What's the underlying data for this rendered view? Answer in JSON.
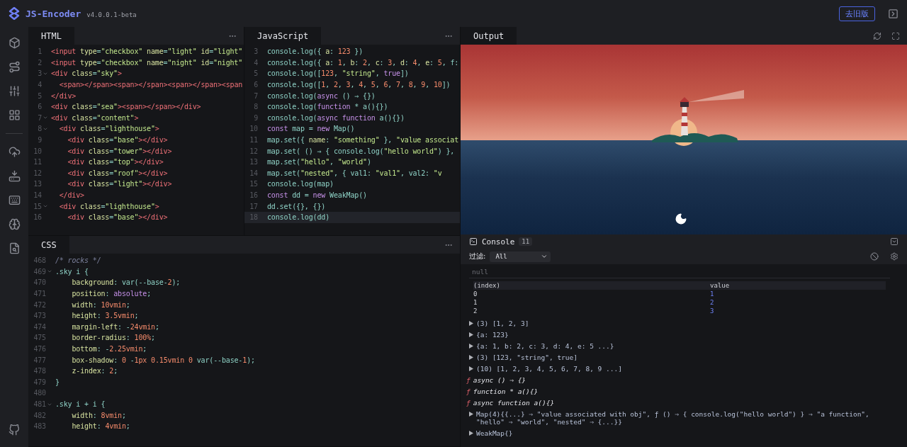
{
  "header": {
    "app_name": "JS-Encoder",
    "version": "v4.0.0.1-beta",
    "old_version_button": "去旧版"
  },
  "html_editor": {
    "tab": "HTML",
    "lines": [
      {
        "n": "1",
        "code": "<input type=\"checkbox\" name=\"light\" id=\"light\"",
        "fold": false
      },
      {
        "n": "2",
        "code": "<input type=\"checkbox\" name=\"night\" id=\"night\"",
        "fold": false
      },
      {
        "n": "3",
        "code": "<div class=\"sky\">",
        "fold": true
      },
      {
        "n": "4",
        "code": "  <span></span><span></span><span></span><span",
        "fold": false
      },
      {
        "n": "5",
        "code": "</div>",
        "fold": false
      },
      {
        "n": "6",
        "code": "<div class=\"sea\"><span></span></div>",
        "fold": false
      },
      {
        "n": "7",
        "code": "<div class=\"content\">",
        "fold": true
      },
      {
        "n": "8",
        "code": "  <div class=\"lighthouse\">",
        "fold": true
      },
      {
        "n": "9",
        "code": "    <div class=\"base\"></div>",
        "fold": false
      },
      {
        "n": "10",
        "code": "    <div class=\"tower\"></div>",
        "fold": false
      },
      {
        "n": "11",
        "code": "    <div class=\"top\"></div>",
        "fold": false
      },
      {
        "n": "12",
        "code": "    <div class=\"roof\"></div>",
        "fold": false
      },
      {
        "n": "13",
        "code": "    <div class=\"light\"></div>",
        "fold": false
      },
      {
        "n": "14",
        "code": "  </div>",
        "fold": false
      },
      {
        "n": "15",
        "code": "  <div class=\"lighthouse\">",
        "fold": true
      },
      {
        "n": "16",
        "code": "    <div class=\"base\"></div>",
        "fold": false
      }
    ]
  },
  "js_editor": {
    "tab": "JavaScript",
    "lines": [
      {
        "n": "3",
        "code": "console.log({ a: 123 })",
        "fold": false,
        "active": false
      },
      {
        "n": "4",
        "code": "console.log({ a: 1, b: 2, c: 3, d: 4, e: 5, f:",
        "fold": false,
        "active": false
      },
      {
        "n": "5",
        "code": "console.log([123, \"string\", true])",
        "fold": false,
        "active": false
      },
      {
        "n": "6",
        "code": "console.log([1, 2, 3, 4, 5, 6, 7, 8, 9, 10])",
        "fold": false,
        "active": false
      },
      {
        "n": "7",
        "code": "console.log(async () ⇒ {})",
        "fold": false,
        "active": false
      },
      {
        "n": "8",
        "code": "console.log(function * a(){})",
        "fold": false,
        "active": false
      },
      {
        "n": "9",
        "code": "console.log(async function a(){})",
        "fold": false,
        "active": false
      },
      {
        "n": "10",
        "code": "const map = new Map()",
        "fold": false,
        "active": false
      },
      {
        "n": "11",
        "code": "map.set({ name: \"something\" }, \"value associat",
        "fold": false,
        "active": false
      },
      {
        "n": "12",
        "code": "map.set( () ⇒ { console.log(\"hello world\") },",
        "fold": false,
        "active": false
      },
      {
        "n": "13",
        "code": "map.set(\"hello\", \"world\")",
        "fold": false,
        "active": false
      },
      {
        "n": "14",
        "code": "map.set(\"nested\", { val1: \"val1\", val2: \"v",
        "fold": false,
        "active": false
      },
      {
        "n": "15",
        "code": "console.log(map)",
        "fold": false,
        "active": false
      },
      {
        "n": "16",
        "code": "const dd = new WeakMap()",
        "fold": false,
        "active": false
      },
      {
        "n": "17",
        "code": "dd.set({}, {})",
        "fold": false,
        "active": false
      },
      {
        "n": "18",
        "code": "console.log(dd)",
        "fold": false,
        "active": true
      }
    ]
  },
  "css_editor": {
    "tab": "CSS",
    "lines": [
      {
        "n": "468",
        "code": "/* rocks */",
        "fold": false
      },
      {
        "n": "469",
        "code": ".sky i {",
        "fold": true
      },
      {
        "n": "470",
        "code": "    background: var(--base-2);",
        "fold": false
      },
      {
        "n": "471",
        "code": "    position: absolute;",
        "fold": false
      },
      {
        "n": "472",
        "code": "    width: 10vmin;",
        "fold": false
      },
      {
        "n": "473",
        "code": "    height: 3.5vmin;",
        "fold": false
      },
      {
        "n": "474",
        "code": "    margin-left: -24vmin;",
        "fold": false
      },
      {
        "n": "475",
        "code": "    border-radius: 100%;",
        "fold": false
      },
      {
        "n": "476",
        "code": "    bottom: -2.25vmin;",
        "fold": false
      },
      {
        "n": "477",
        "code": "    box-shadow: 0 -1px 0.15vmin 0 var(--base-1);",
        "fold": false
      },
      {
        "n": "478",
        "code": "    z-index: 2;",
        "fold": false
      },
      {
        "n": "479",
        "code": "}",
        "fold": false
      },
      {
        "n": "480",
        "fold": false
      },
      {
        "n": "481",
        "code": ".sky i + i {",
        "fold": true
      },
      {
        "n": "482",
        "code": "    width: 8vmin;",
        "fold": false
      },
      {
        "n": "483",
        "code": "    height: 4vmin;",
        "fold": false
      }
    ]
  },
  "output": {
    "tab": "Output"
  },
  "console": {
    "title": "Console",
    "count": "11",
    "filter_label": "过滤:",
    "filter_value": "All",
    "entries": [
      {
        "kind": "plain",
        "text": "null"
      },
      {
        "kind": "table",
        "columns": [
          "(index)",
          "value"
        ],
        "rows": [
          [
            "0",
            "1"
          ],
          [
            "1",
            "2"
          ],
          [
            "2",
            "3"
          ]
        ]
      },
      {
        "kind": "object",
        "text": "(3) [1, 2, 3]"
      },
      {
        "kind": "object",
        "text": "{a: 123}"
      },
      {
        "kind": "object",
        "text": "{a: 1, b: 2, c: 3, d: 4, e: 5 ...}"
      },
      {
        "kind": "object",
        "text": "(3) [123, \"string\", true]"
      },
      {
        "kind": "object",
        "text": "(10) [1, 2, 3, 4, 5, 6, 7, 8, 9 ...]"
      },
      {
        "kind": "function",
        "prefix": "ƒ",
        "text": "async () ⇒ {}"
      },
      {
        "kind": "function",
        "prefix": "ƒ",
        "text": "function * a(){}"
      },
      {
        "kind": "function",
        "prefix": "ƒ",
        "text": "async function a(){}"
      },
      {
        "kind": "object",
        "text": "Map(4){{...} ⇒ \"value associated with obj\", ƒ () ⇒ { console.log(\"hello world\") } ⇒ \"a function\", \"hello\" ⇒ \"world\", \"nested\" ⇒ {...}}"
      },
      {
        "kind": "object",
        "text": "WeakMap{}"
      }
    ]
  }
}
